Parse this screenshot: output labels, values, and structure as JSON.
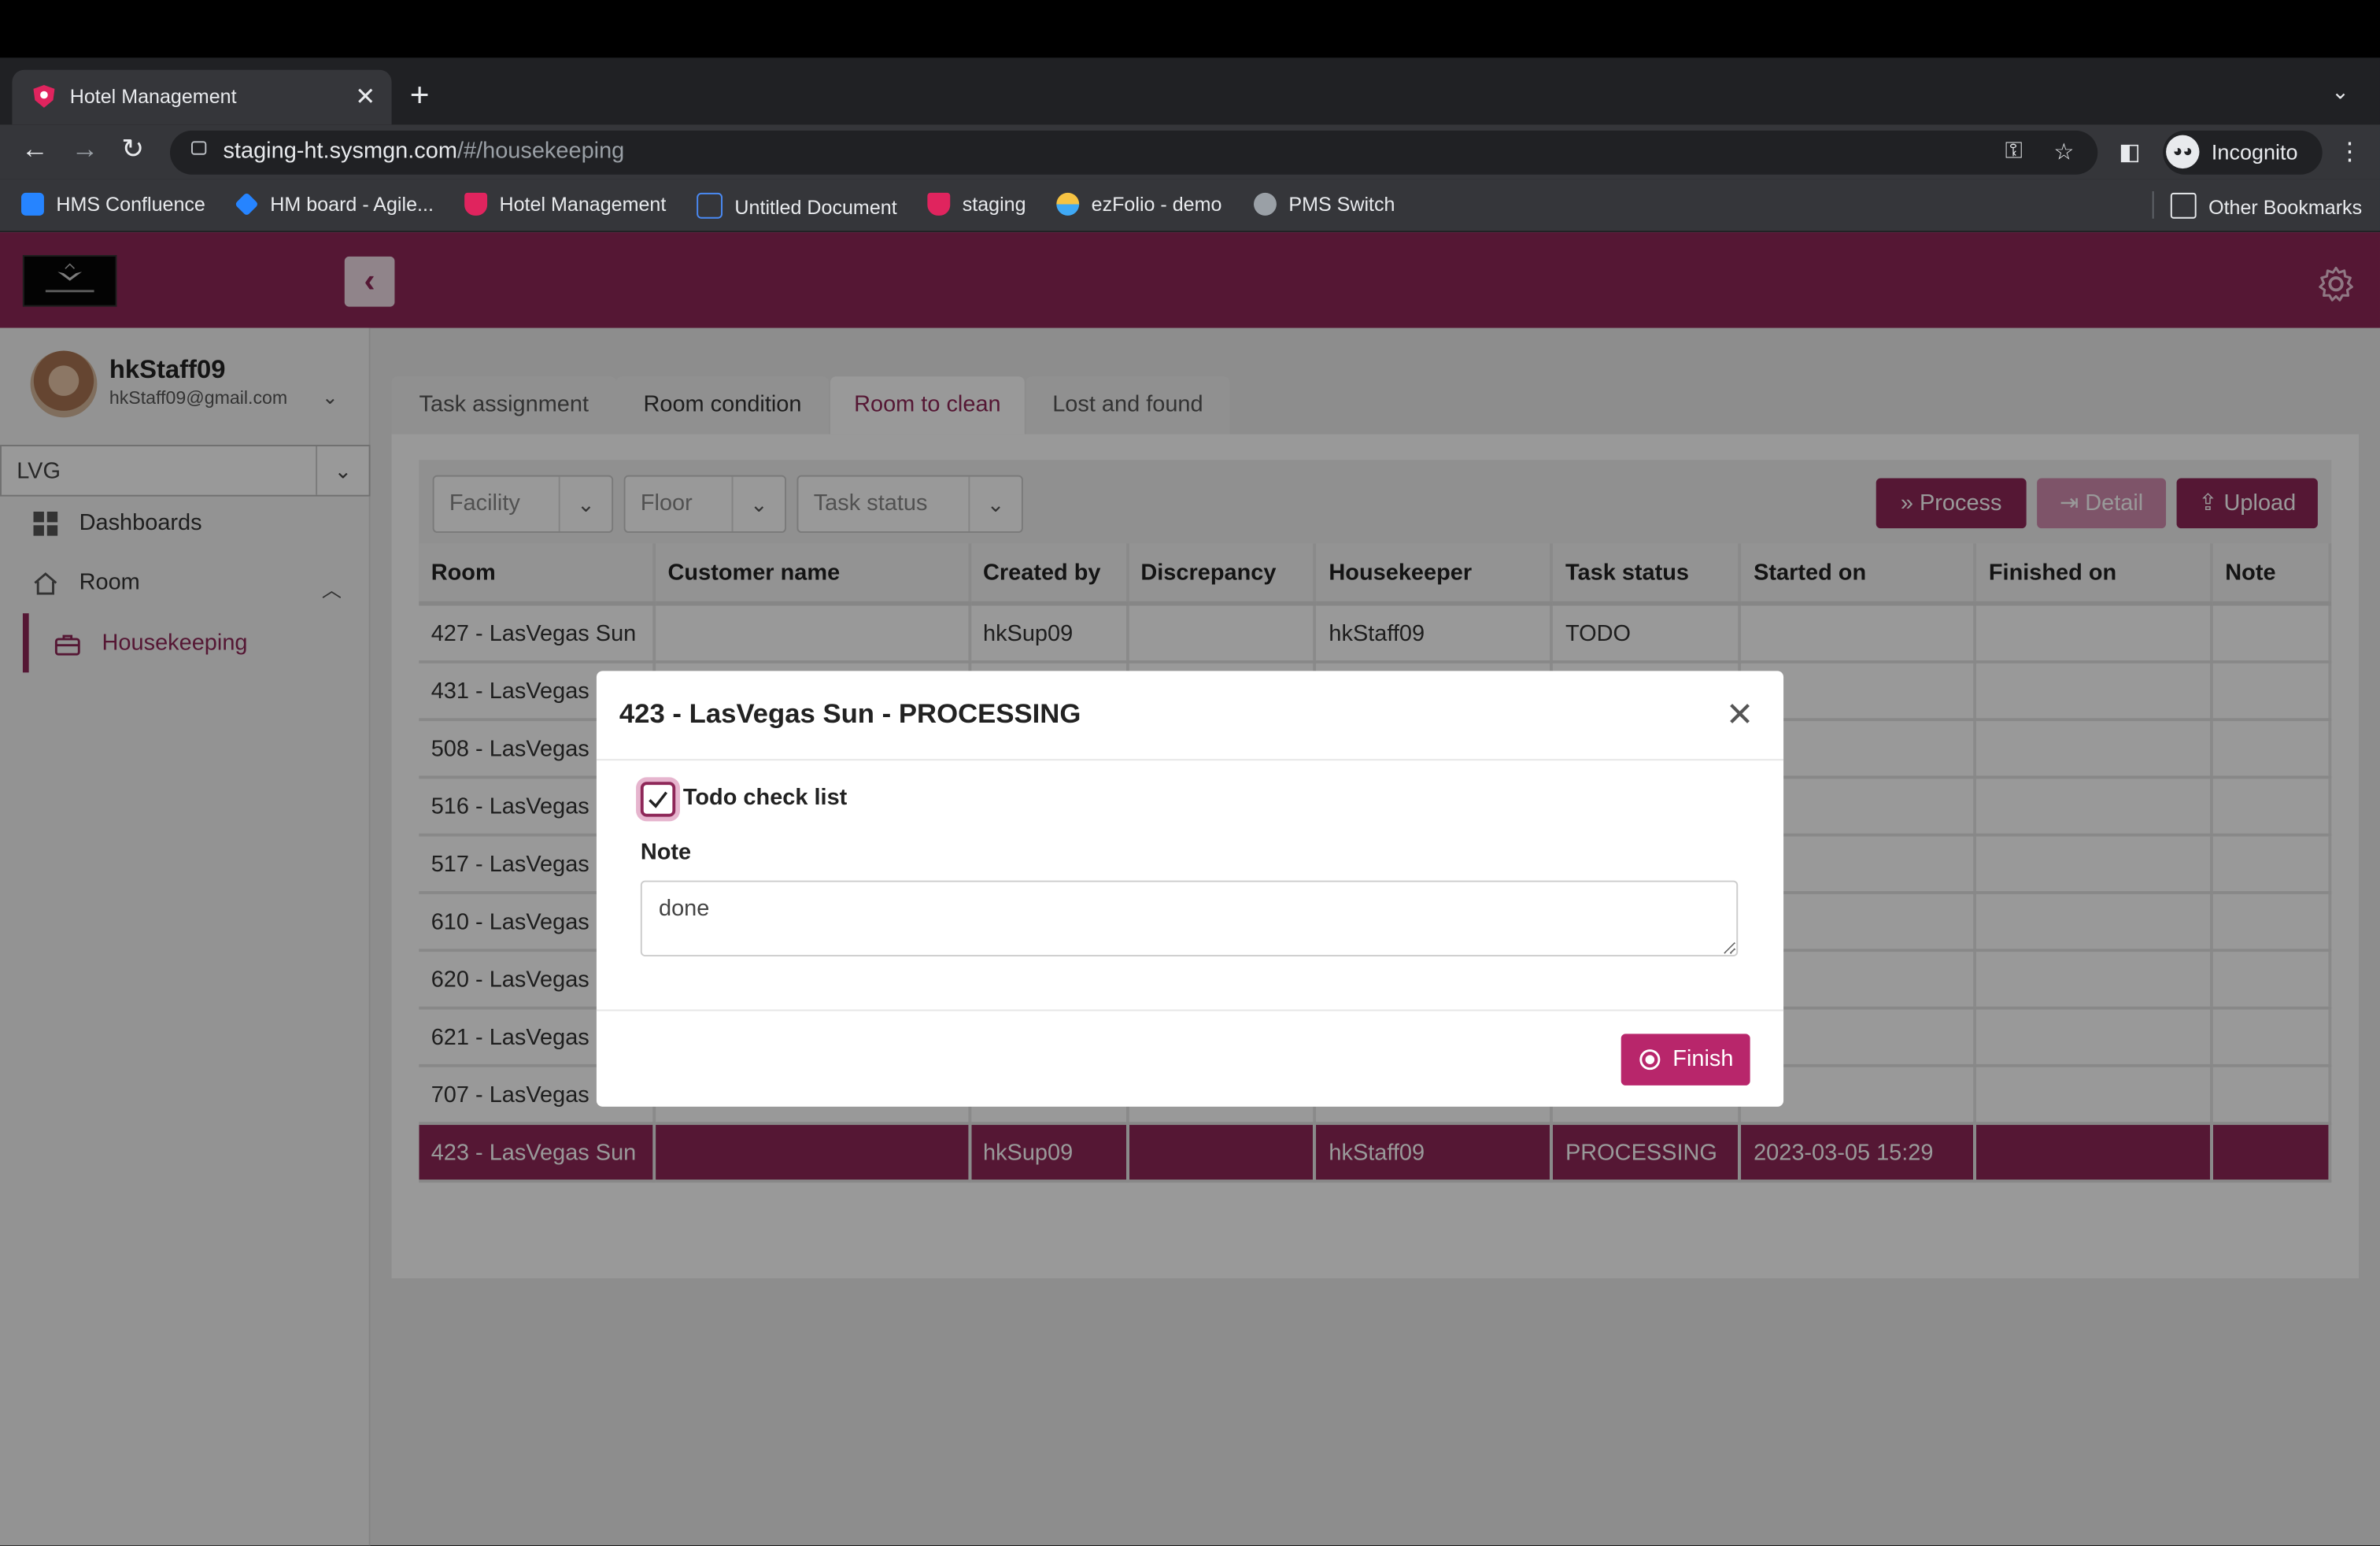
{
  "browser": {
    "tab_title": "Hotel Management",
    "url_main": "staging-ht.sysmgn.com",
    "url_path": "/#/housekeeping",
    "profile_label": "Incognito",
    "bookmarks": [
      "HMS Confluence",
      "HM board - Agile...",
      "Hotel Management",
      "Untitled Document",
      "staging",
      "ezFolio - demo",
      "PMS Switch"
    ],
    "other_bookmarks": "Other Bookmarks"
  },
  "user": {
    "name": "hkStaff09",
    "email": "hkStaff09@gmail.com"
  },
  "sidebar": {
    "hotel": "LVG",
    "items": [
      {
        "label": "Dashboards",
        "icon": "grid-icon"
      },
      {
        "label": "Room",
        "icon": "home-icon"
      },
      {
        "label": "Housekeeping",
        "icon": "briefcase-icon"
      }
    ]
  },
  "tabs": [
    "Task assignment",
    "Room condition",
    "Room to clean",
    "Lost and found"
  ],
  "active_tab": "Room to clean",
  "filters": {
    "facility": "Facility",
    "floor": "Floor",
    "task_status": "Task status"
  },
  "actions": {
    "process": "Process",
    "detail": "Detail",
    "upload": "Upload"
  },
  "table": {
    "columns": [
      "Room",
      "Customer name",
      "Created by",
      "Discrepancy",
      "Housekeeper",
      "Task status",
      "Started on",
      "Finished on",
      "Note"
    ],
    "rows": [
      [
        "427 - LasVegas Sun",
        "",
        "hkSup09",
        "",
        "hkStaff09",
        "TODO",
        "",
        "",
        ""
      ],
      [
        "431 - LasVegas",
        "",
        "",
        "",
        "",
        "",
        "",
        "",
        ""
      ],
      [
        "508 - LasVegas",
        "",
        "",
        "",
        "",
        "",
        "",
        "",
        ""
      ],
      [
        "516 - LasVegas",
        "",
        "",
        "",
        "",
        "",
        "",
        "",
        ""
      ],
      [
        "517 - LasVegas",
        "",
        "",
        "",
        "",
        "",
        "",
        "",
        ""
      ],
      [
        "610 - LasVegas",
        "",
        "",
        "",
        "",
        "",
        "",
        "",
        ""
      ],
      [
        "620 - LasVegas",
        "",
        "",
        "",
        "",
        "",
        "",
        "",
        ""
      ],
      [
        "621 - LasVegas",
        "",
        "",
        "",
        "",
        "",
        "",
        "",
        ""
      ],
      [
        "707 - LasVegas",
        "",
        "",
        "",
        "",
        "",
        "",
        "",
        ""
      ],
      [
        "423 - LasVegas Sun",
        "",
        "hkSup09",
        "",
        "hkStaff09",
        "PROCESSING",
        "2023-03-05 15:29",
        "",
        ""
      ]
    ],
    "selected_row": 9
  },
  "modal": {
    "title": "423 - LasVegas Sun - PROCESSING",
    "checkbox_label": "Todo check list",
    "checkbox_checked": true,
    "note_label": "Note",
    "note_value": "done",
    "finish_label": "Finish"
  },
  "colors": {
    "brand": "#8e2758",
    "finish": "#b8266b"
  }
}
